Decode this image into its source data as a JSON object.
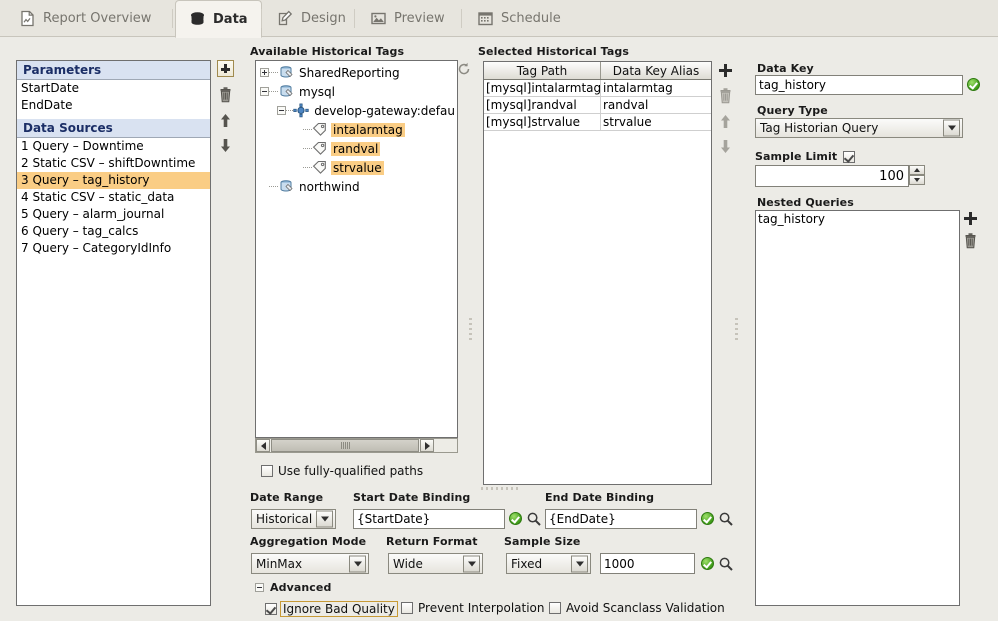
{
  "tabs": [
    {
      "label": "Report Overview",
      "icon": "report-icon",
      "active": false
    },
    {
      "label": "Data",
      "icon": "database-icon",
      "active": true
    },
    {
      "label": "Design",
      "icon": "pencil-square-icon",
      "active": false
    },
    {
      "label": "Preview",
      "icon": "image-icon",
      "active": false
    },
    {
      "label": "Schedule",
      "icon": "calendar-icon",
      "active": false
    }
  ],
  "left_panel": {
    "parameters_header": "Parameters",
    "parameters": [
      "StartDate",
      "EndDate"
    ],
    "data_sources_header": "Data Sources",
    "data_sources": [
      {
        "label": "1 Query – Downtime",
        "selected": false
      },
      {
        "label": "2 Static CSV – shiftDowntime",
        "selected": false
      },
      {
        "label": "3 Query – tag_history",
        "selected": true
      },
      {
        "label": "4 Static CSV – static_data",
        "selected": false
      },
      {
        "label": "5 Query – alarm_journal",
        "selected": false
      },
      {
        "label": "6 Query – tag_calcs",
        "selected": false
      },
      {
        "label": "7 Query – CategoryIdInfo",
        "selected": false
      }
    ],
    "buttons": [
      "add-datasource-button",
      "delete-datasource-button",
      "move-up-button",
      "move-down-button"
    ]
  },
  "tree_panel": {
    "title": "Available Historical Tags",
    "refresh_icon": "refresh-icon",
    "nodes": [
      {
        "label": "SharedReporting",
        "depth": 0,
        "expander": "plus",
        "icon": "database-tag-icon",
        "highlight": false
      },
      {
        "label": "mysql",
        "depth": 0,
        "expander": "minus",
        "icon": "database-tag-icon",
        "highlight": false
      },
      {
        "label": "develop-gateway:defau",
        "depth": 1,
        "expander": "minus",
        "icon": "gateway-icon",
        "highlight": false
      },
      {
        "label": "intalarmtag",
        "depth": 2,
        "expander": "none",
        "icon": "tag-icon",
        "highlight": true
      },
      {
        "label": "randval",
        "depth": 2,
        "expander": "none",
        "icon": "tag-icon",
        "highlight": true
      },
      {
        "label": "strvalue",
        "depth": 2,
        "expander": "none",
        "icon": "tag-icon",
        "highlight": true
      },
      {
        "label": "northwind",
        "depth": 0,
        "expander": "none",
        "icon": "database-tag-icon",
        "highlight": false
      }
    ],
    "fully_qualified_label": "Use fully-qualified paths",
    "fully_qualified_checked": false
  },
  "selected_tags": {
    "title": "Selected Historical Tags",
    "columns": [
      "Tag Path",
      "Data Key Alias"
    ],
    "rows": [
      [
        "[mysql]intalarmtag",
        "intalarmtag"
      ],
      [
        "[mysql]randval",
        "randval"
      ],
      [
        "[mysql]strvalue",
        "strvalue"
      ]
    ],
    "buttons": [
      "add-tag-button",
      "delete-tag-button",
      "move-tag-up-button",
      "move-tag-down-button"
    ]
  },
  "right_panel": {
    "data_key_label": "Data Key",
    "data_key_value": "tag_history",
    "query_type_label": "Query Type",
    "query_type_value": "Tag Historian Query",
    "sample_limit_label": "Sample Limit",
    "sample_limit_checked": true,
    "sample_limit_value": "100",
    "nested_queries_label": "Nested Queries",
    "nested_queries": [
      "tag_history"
    ],
    "nested_buttons": [
      "add-nested-query-button",
      "delete-nested-query-button"
    ]
  },
  "bottom": {
    "date_range_label": "Date Range",
    "date_range_value": "Historical",
    "start_date_label": "Start Date Binding",
    "start_date_value": "{StartDate}",
    "end_date_label": "End Date Binding",
    "end_date_value": "{EndDate}",
    "aggregation_label": "Aggregation Mode",
    "aggregation_value": "MinMax",
    "return_format_label": "Return Format",
    "return_format_value": "Wide",
    "sample_size_label": "Sample Size",
    "sample_size_mode": "Fixed",
    "sample_size_value": "1000",
    "advanced_label": "Advanced",
    "advanced_expanded": true,
    "advanced_options": [
      {
        "label": "Ignore Bad Quality",
        "checked": true,
        "focused": true
      },
      {
        "label": "Prevent Interpolation",
        "checked": false,
        "focused": false
      },
      {
        "label": "Avoid Scanclass Validation",
        "checked": false,
        "focused": false
      }
    ]
  },
  "colors": {
    "background": "#ECEBE6",
    "tab_active_bg": "#F5F3EE",
    "selection_highlight": "#FACD85",
    "section_header_bg": "#D9E2F1",
    "section_header_text": "#1B2E66",
    "focus_border": "#C79A36",
    "ok_green": "#3F9B19"
  }
}
